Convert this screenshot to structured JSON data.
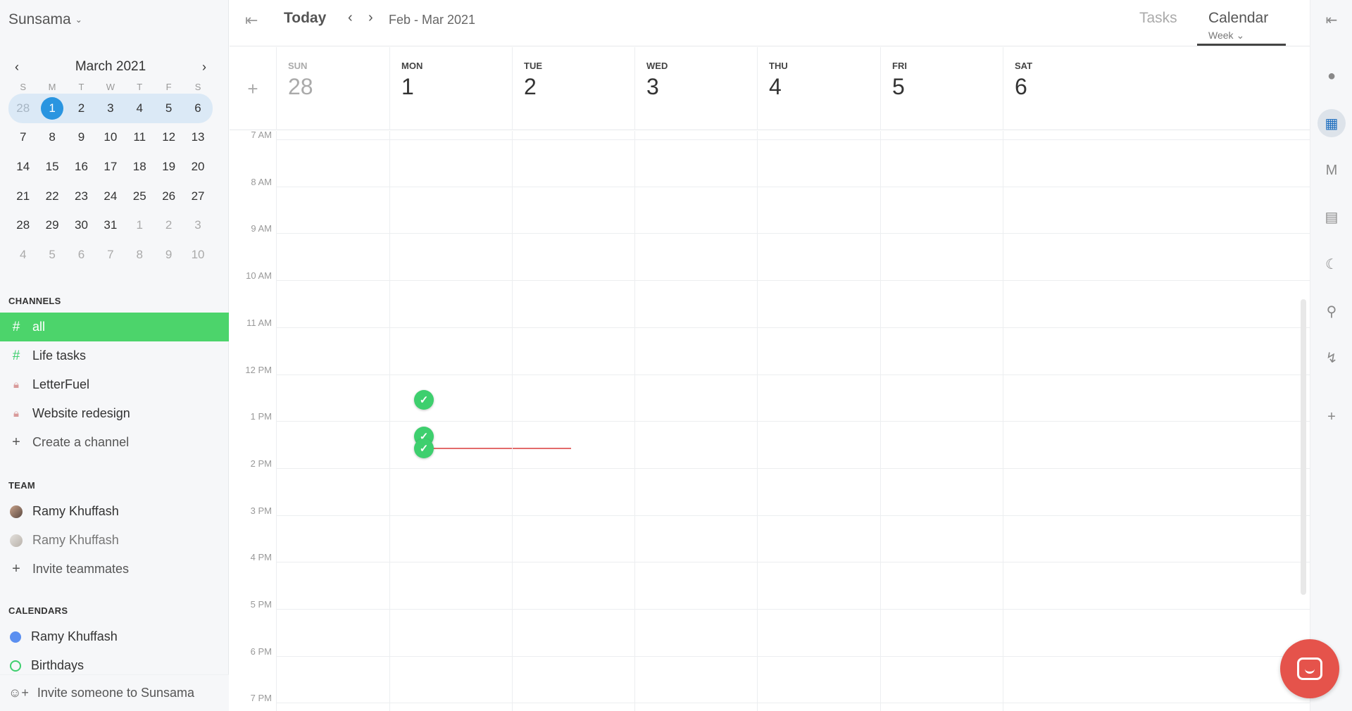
{
  "app": {
    "name": "Sunsama"
  },
  "minical": {
    "title": "March 2021",
    "dow": [
      "S",
      "M",
      "T",
      "W",
      "T",
      "F",
      "S"
    ],
    "weeks": [
      [
        "28",
        "1",
        "2",
        "3",
        "4",
        "5",
        "6"
      ],
      [
        "7",
        "8",
        "9",
        "10",
        "11",
        "12",
        "13"
      ],
      [
        "14",
        "15",
        "16",
        "17",
        "18",
        "19",
        "20"
      ],
      [
        "21",
        "22",
        "23",
        "24",
        "25",
        "26",
        "27"
      ],
      [
        "28",
        "29",
        "30",
        "31",
        "1",
        "2",
        "3"
      ],
      [
        "4",
        "5",
        "6",
        "7",
        "8",
        "9",
        "10"
      ]
    ],
    "selected": "1"
  },
  "channels": {
    "label": "CHANNELS",
    "items": [
      {
        "label": "all",
        "icon": "hash-icon",
        "active": true
      },
      {
        "label": "Life tasks",
        "icon": "hash-icon"
      },
      {
        "label": "LetterFuel",
        "icon": "lock-icon"
      },
      {
        "label": "Website redesign",
        "icon": "lock-icon"
      }
    ],
    "create": "Create a channel"
  },
  "team": {
    "label": "TEAM",
    "members": [
      "Ramy Khuffash",
      "Ramy Khuffash"
    ],
    "invite": "Invite teammates"
  },
  "calendars": {
    "label": "CALENDARS",
    "items": [
      {
        "label": "Ramy Khuffash",
        "color": "#5b8ff0"
      },
      {
        "label": "Birthdays",
        "color": "#3ecf6e"
      }
    ]
  },
  "bottom": {
    "invite": "Invite someone to Sunsama"
  },
  "topbar": {
    "today": "Today",
    "range": "Feb - Mar 2021",
    "tasks": "Tasks",
    "calendar": "Calendar",
    "view": "Week"
  },
  "days": [
    {
      "dow": "SUN",
      "num": "28",
      "past": true
    },
    {
      "dow": "MON",
      "num": "1"
    },
    {
      "dow": "TUE",
      "num": "2"
    },
    {
      "dow": "WED",
      "num": "3"
    },
    {
      "dow": "THU",
      "num": "4"
    },
    {
      "dow": "FRI",
      "num": "5"
    },
    {
      "dow": "SAT",
      "num": "6"
    }
  ],
  "hours": [
    "7 AM",
    "8 AM",
    "9 AM",
    "10 AM",
    "11 AM",
    "12 PM",
    "1 PM",
    "2 PM",
    "3 PM",
    "4 PM",
    "5 PM",
    "6 PM",
    "7 PM"
  ],
  "rail": [
    "chat-icon",
    "trello-icon",
    "gmail-icon",
    "archive-icon",
    "moon-icon",
    "search-icon",
    "bolt-icon",
    "plus-icon"
  ],
  "colors": {
    "accent": "#4cd46b",
    "selected": "#2a95e0",
    "now": "#e36b6b",
    "chat": "#e5534b"
  }
}
